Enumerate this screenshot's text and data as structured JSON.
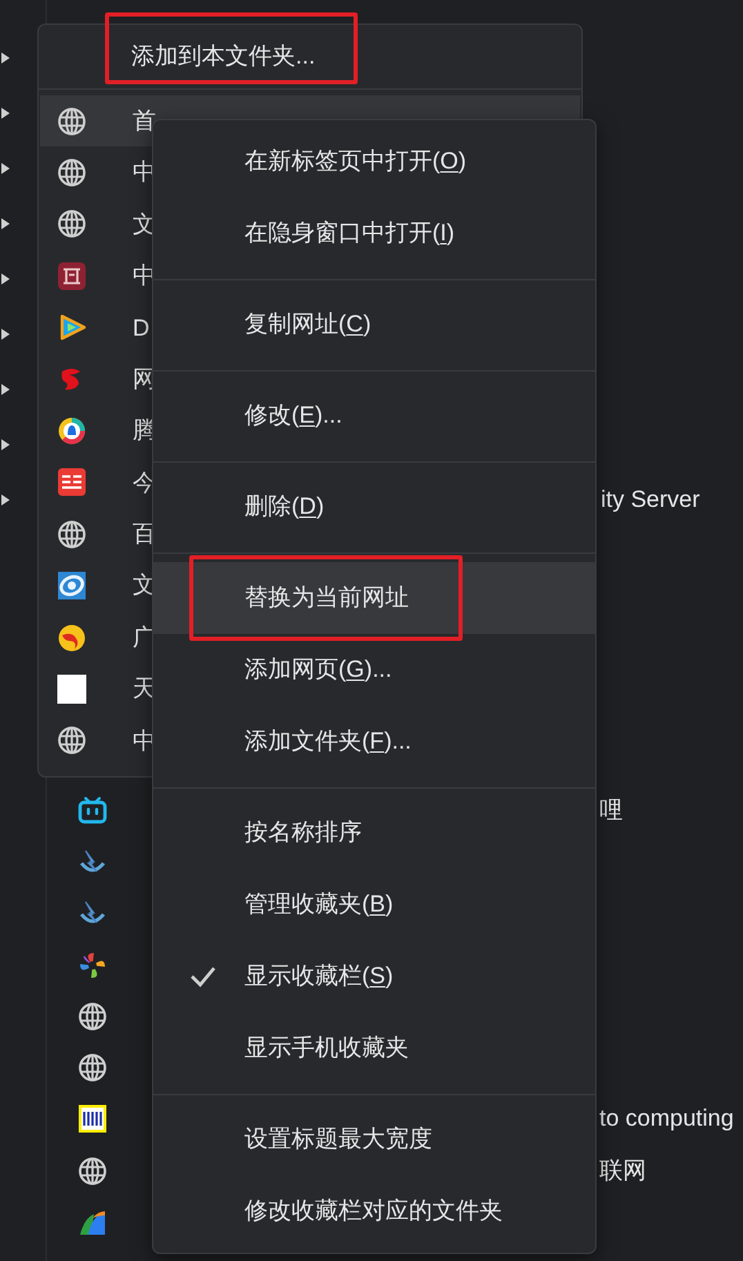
{
  "tree": {
    "items": [
      {
        "expanded": false
      },
      {
        "expanded": false
      },
      {
        "expanded": false
      },
      {
        "expanded": false
      },
      {
        "expanded": false
      },
      {
        "expanded": false
      },
      {
        "expanded": false
      },
      {
        "expanded": false
      },
      {
        "expanded": false
      }
    ]
  },
  "background": {
    "partial_title": "ity Server",
    "rows": [
      {
        "kind": "tv",
        "tail": "哩"
      },
      {
        "kind": "bolt"
      },
      {
        "kind": "bolt"
      },
      {
        "kind": "pinwheel"
      },
      {
        "kind": "globe"
      },
      {
        "kind": "globe"
      },
      {
        "kind": "dw",
        "tail": "to computing"
      },
      {
        "kind": "globe",
        "tail": "联网"
      },
      {
        "kind": "wing"
      }
    ]
  },
  "folder_menu": {
    "command": {
      "label": "添加到本文件夹...",
      "highlighted": true
    },
    "bookmarks": [
      {
        "kind": "globe",
        "label": "首",
        "hovered": true
      },
      {
        "kind": "globe",
        "label": "中",
        "hovered": false
      },
      {
        "kind": "globe",
        "label": "文",
        "hovered": false
      },
      {
        "kind": "gate",
        "label": "中",
        "hovered": false
      },
      {
        "kind": "play",
        "label": "D",
        "hovered": false
      },
      {
        "kind": "knot",
        "label": "网",
        "hovered": false
      },
      {
        "kind": "ring",
        "label": "腾",
        "hovered": false
      },
      {
        "kind": "news",
        "label": "今",
        "hovered": false
      },
      {
        "kind": "globe",
        "label": "百",
        "hovered": false
      },
      {
        "kind": "orbit",
        "label": "文",
        "hovered": false
      },
      {
        "kind": "flame",
        "label": "广",
        "hovered": false
      },
      {
        "kind": "blank",
        "label": "天",
        "hovered": false
      },
      {
        "kind": "globe",
        "label": "中",
        "hovered": false
      }
    ]
  },
  "context_menu": {
    "items": [
      {
        "kind": "item",
        "text": "在新标签页中打开(",
        "key": "O",
        "after": ")",
        "checked": false,
        "hovered": false,
        "highlighted": false
      },
      {
        "kind": "item",
        "text": "在隐身窗口中打开(",
        "key": "I",
        "after": ")",
        "checked": false,
        "hovered": false,
        "highlighted": false
      },
      {
        "kind": "separator"
      },
      {
        "kind": "item",
        "text": "复制网址(",
        "key": "C",
        "after": ")",
        "checked": false,
        "hovered": false,
        "highlighted": false
      },
      {
        "kind": "separator"
      },
      {
        "kind": "item",
        "text": "修改(",
        "key": "E",
        "after": ")...",
        "checked": false,
        "hovered": false,
        "highlighted": false
      },
      {
        "kind": "separator"
      },
      {
        "kind": "item",
        "text": "删除(",
        "key": "D",
        "after": ")",
        "checked": false,
        "hovered": false,
        "highlighted": false
      },
      {
        "kind": "separator"
      },
      {
        "kind": "item",
        "text": "替换为当前网址",
        "checked": false,
        "hovered": true,
        "highlighted": true
      },
      {
        "kind": "item",
        "text": "添加网页(",
        "key": "G",
        "after": ")...",
        "checked": false,
        "hovered": false,
        "highlighted": false
      },
      {
        "kind": "item",
        "text": "添加文件夹(",
        "key": "F",
        "after": ")...",
        "checked": false,
        "hovered": false,
        "highlighted": false
      },
      {
        "kind": "separator"
      },
      {
        "kind": "item",
        "text": "按名称排序",
        "checked": false,
        "hovered": false,
        "highlighted": false
      },
      {
        "kind": "item",
        "text": "管理收藏夹(",
        "key": "B",
        "after": ")",
        "checked": false,
        "hovered": false,
        "highlighted": false
      },
      {
        "kind": "item",
        "text": "显示收藏栏(",
        "key": "S",
        "after": ")",
        "checked": true,
        "hovered": false,
        "highlighted": false
      },
      {
        "kind": "item",
        "text": "显示手机收藏夹",
        "checked": false,
        "hovered": false,
        "highlighted": false
      },
      {
        "kind": "separator"
      },
      {
        "kind": "item",
        "text": "设置标题最大宽度",
        "checked": false,
        "hovered": false,
        "highlighted": false
      },
      {
        "kind": "item",
        "text": "修改收藏栏对应的文件夹",
        "checked": false,
        "hovered": false,
        "highlighted": false
      }
    ]
  }
}
